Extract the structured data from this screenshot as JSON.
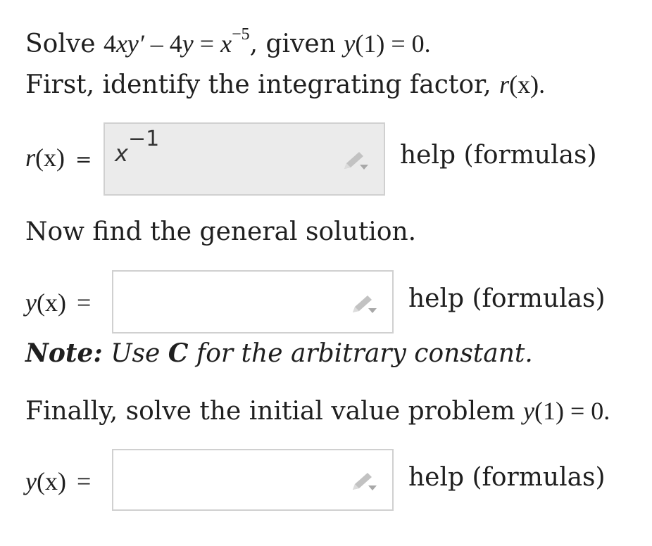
{
  "problem": {
    "solve_word": "Solve",
    "equation_lhs_a": "4",
    "equation_lhs_b": "xy′",
    "equation_minus": " – 4",
    "equation_y": "y",
    "equation_eq": " = ",
    "equation_x": "x",
    "equation_exp": "−5",
    "given_text": ", given",
    "ic_func": "y",
    "ic_arg": "(1) = 0.",
    "step1": "First, identify the integrating factor,",
    "step1_func": "r",
    "step1_arg": "(x).",
    "step2": "Now find the general solution.",
    "note_label": "Note:",
    "note_text_a": "Use",
    "note_c": "C",
    "note_text_b": "for the arbitrary constant.",
    "step3": "Finally, solve the initial value problem",
    "step3_func": "y",
    "step3_arg": "(1) = 0."
  },
  "fields": {
    "r_label_func": "r",
    "r_label_arg": "(x)",
    "r_label_eq": "=",
    "r_value_base": "x",
    "r_value_exp": "−1",
    "general_label_func": "y",
    "general_label_arg": "(x)",
    "general_label_eq": "=",
    "ivp_label_func": "y",
    "ivp_label_arg": "(x)",
    "ivp_label_eq": "="
  },
  "help": {
    "label_1": "help (formulas)",
    "label_2": "help (formulas)",
    "label_3": "help (formulas)"
  },
  "colors": {
    "filled_box": "#ebebeb",
    "box_border": "#d0d0d0",
    "pencil": "#b5b5b5"
  }
}
